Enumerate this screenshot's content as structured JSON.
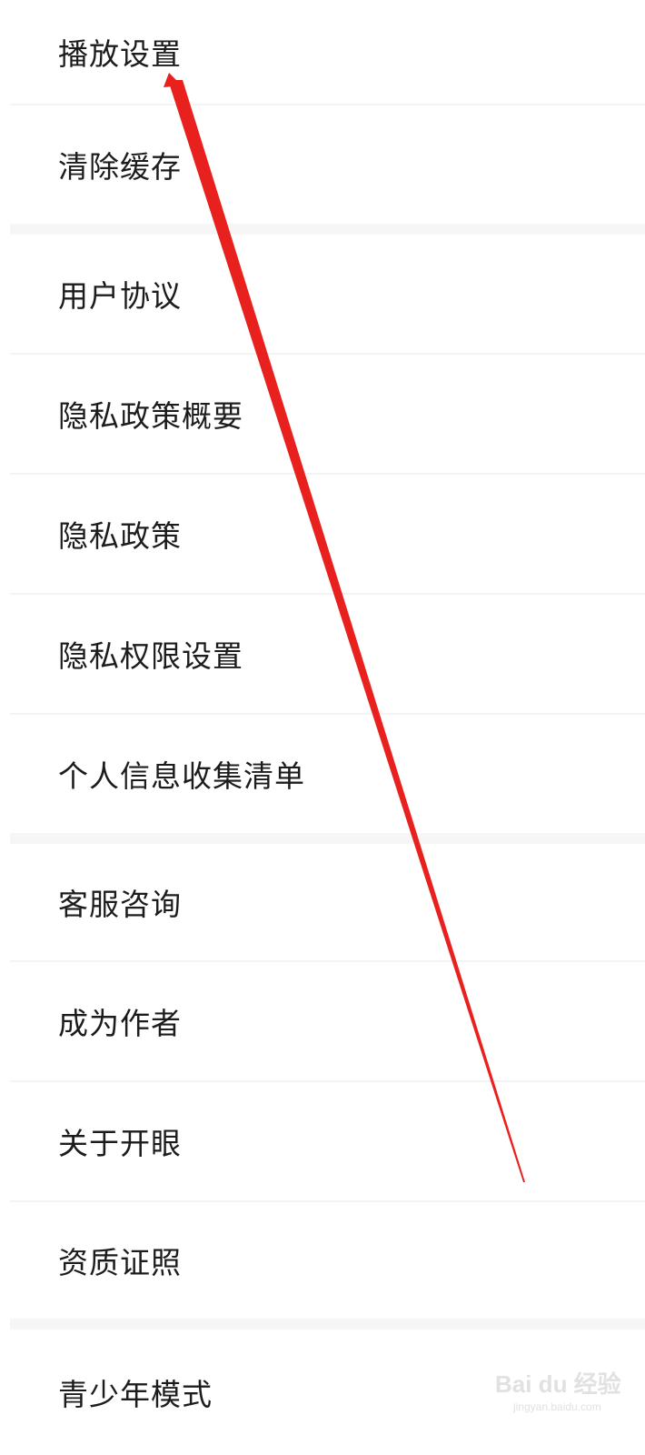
{
  "menu": {
    "items": [
      {
        "label": "播放设置"
      },
      {
        "label": "清除缓存"
      },
      {
        "label": "用户协议"
      },
      {
        "label": "隐私政策概要"
      },
      {
        "label": "隐私政策"
      },
      {
        "label": "隐私权限设置"
      },
      {
        "label": "个人信息收集清单"
      },
      {
        "label": "客服咨询"
      },
      {
        "label": "成为作者"
      },
      {
        "label": "关于开眼"
      },
      {
        "label": "资质证照"
      },
      {
        "label": "青少年模式"
      }
    ]
  },
  "annotation": {
    "arrow_color": "#e8211e",
    "icon": "red-arrow-icon"
  },
  "watermark": {
    "logo_text": "Bai du 经验",
    "domain": "jingyan.baidu.com"
  }
}
